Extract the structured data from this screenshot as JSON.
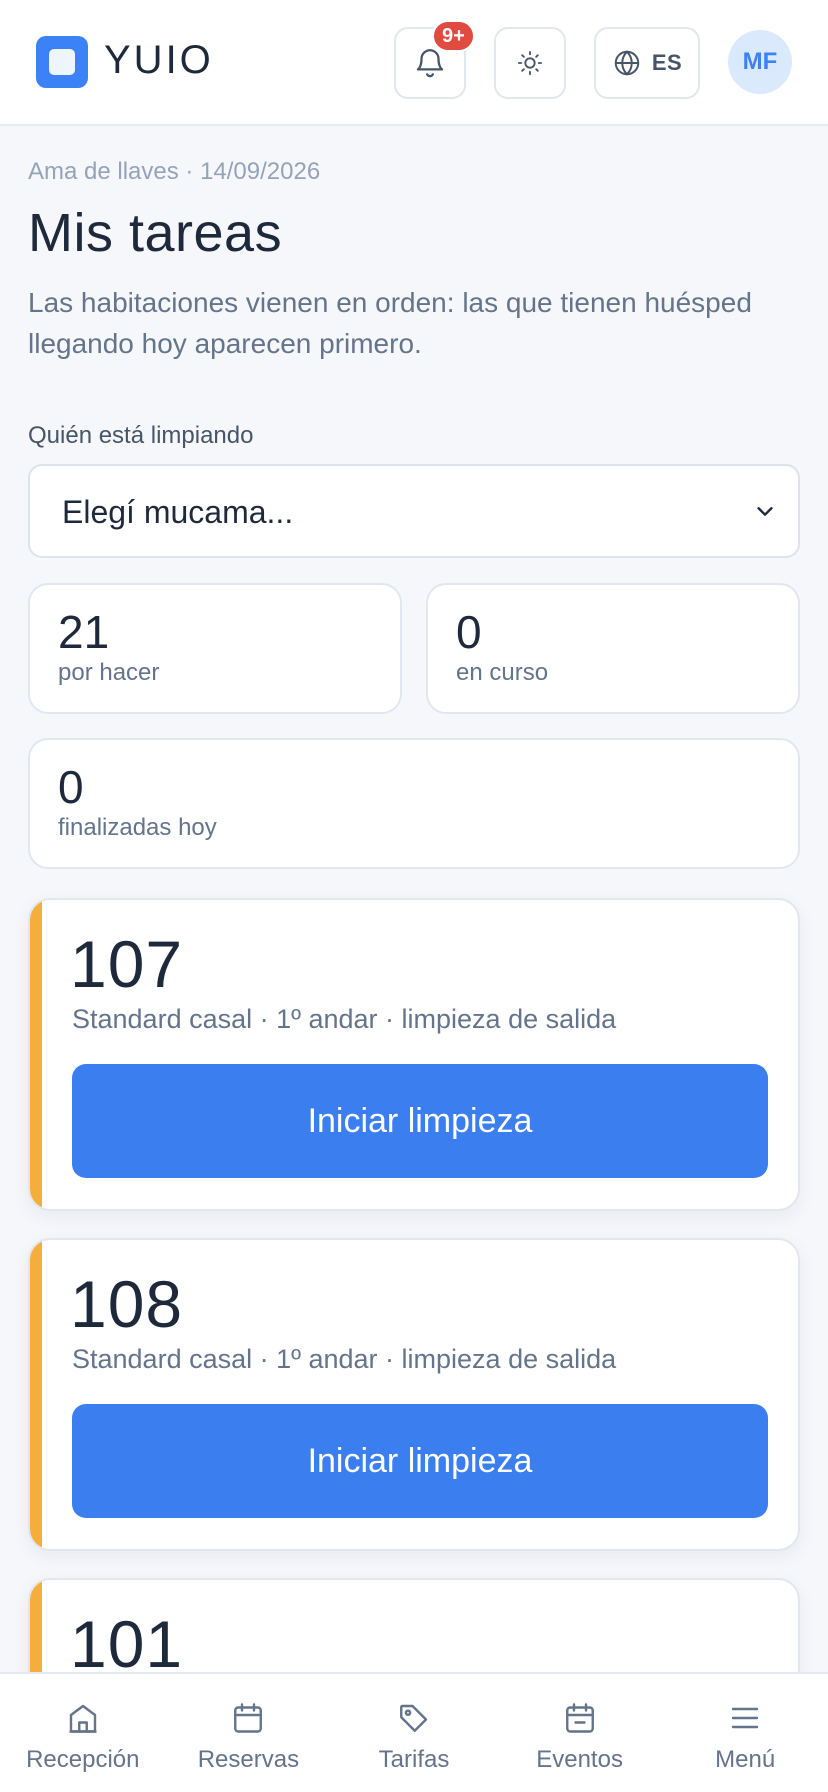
{
  "header": {
    "brand": "YUIO",
    "notifications_badge": "9+",
    "language": "ES",
    "avatar_initials": "MF"
  },
  "page": {
    "breadcrumb": "Ama de llaves · 14/09/2026",
    "title": "Mis tareas",
    "subtitle": "Las habitaciones vienen en orden: las que tienen huésped llegando hoy aparecen primero."
  },
  "filter": {
    "label": "Quién está limpiando",
    "selected": "Elegí mucama..."
  },
  "stats": [
    {
      "value": "21",
      "label": "por hacer"
    },
    {
      "value": "0",
      "label": "en curso"
    },
    {
      "value": "0",
      "label": "finalizadas hoy"
    }
  ],
  "rooms": [
    {
      "number": "107",
      "meta": "Standard casal · 1º andar · limpieza de salida",
      "action": "Iniciar limpieza"
    },
    {
      "number": "108",
      "meta": "Standard casal · 1º andar · limpieza de salida",
      "action": "Iniciar limpieza"
    },
    {
      "number": "101"
    }
  ],
  "nav": [
    {
      "label": "Recepción",
      "icon": "home-icon"
    },
    {
      "label": "Reservas",
      "icon": "calendar-icon"
    },
    {
      "label": "Tarifas",
      "icon": "tag-icon"
    },
    {
      "label": "Eventos",
      "icon": "calendar-event-icon"
    },
    {
      "label": "Menú",
      "icon": "menu-icon"
    }
  ],
  "colors": {
    "accent": "#3b7ef0",
    "priority_stripe": "#f5ad3b",
    "badge": "#e04a3f"
  }
}
